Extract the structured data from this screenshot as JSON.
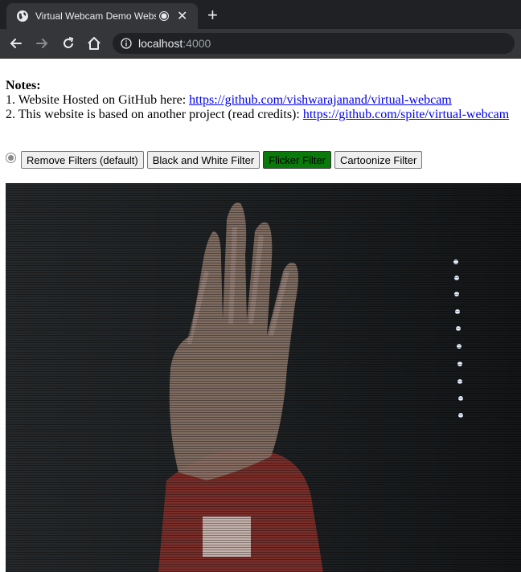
{
  "browser": {
    "tab_title": "Virtual Webcam Demo Website",
    "close_glyph": "✕",
    "newtab_glyph": "+",
    "url_host": "localhost",
    "url_port": ":4000"
  },
  "notes": {
    "heading": "Notes:",
    "line1_prefix": "1. Website Hosted on GitHub here: ",
    "line1_link": "https://github.com/vishwarajanand/virtual-webcam",
    "line2_prefix": "2. This website is based on another project (read credits): ",
    "line2_link": "https://github.com/spite/virtual-webcam"
  },
  "filters": {
    "buttons": [
      {
        "label": "Remove Filters (default)",
        "active": false
      },
      {
        "label": "Black and White Filter",
        "active": false
      },
      {
        "label": "Flicker Filter",
        "active": true
      },
      {
        "label": "Cartoonize Filter",
        "active": false
      }
    ]
  },
  "colors": {
    "active_filter": "#0a7a0a",
    "link": "#0000ee",
    "chrome_dark": "#202124"
  },
  "icons": {
    "favicon": "globe-icon",
    "recording": "recording-icon",
    "back": "back-arrow-icon",
    "forward": "forward-arrow-icon",
    "reload": "reload-icon",
    "home": "home-icon",
    "info": "info-icon"
  }
}
